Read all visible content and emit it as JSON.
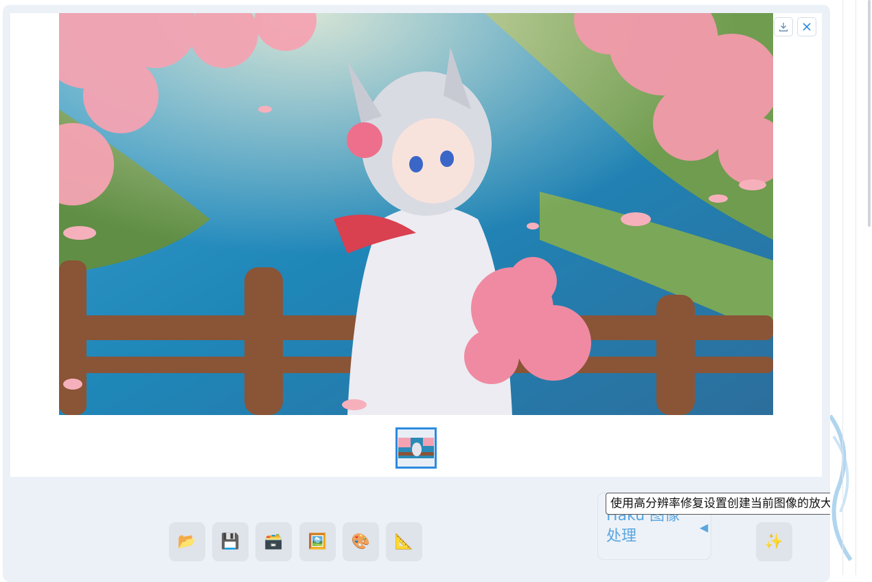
{
  "gallery": {
    "download_icon": "download-icon",
    "close_icon": "close-icon",
    "main_image_alt": "anime girl with cat ears among cherry blossoms",
    "thumbnail_count": 1
  },
  "toolbar": {
    "buttons": [
      {
        "name": "open-folder-button",
        "icon": "📂"
      },
      {
        "name": "save-button",
        "icon": "💾"
      },
      {
        "name": "zip-save-button",
        "icon": "🗃️"
      },
      {
        "name": "send-to-image-button",
        "icon": "🖼️"
      },
      {
        "name": "send-to-inpaint-button",
        "icon": "🎨"
      },
      {
        "name": "send-to-extras-button",
        "icon": "📐"
      }
    ],
    "upscale_icon": "✨"
  },
  "haku": {
    "label": "Haku 图像处理",
    "arrow": "◀"
  },
  "tooltip": {
    "text": "使用高分辨率修复设置创建当前图像的放大版本"
  },
  "colors": {
    "accent": "#2a8ae0",
    "panel_bg": "#ecf1f8",
    "button_bg": "#dfe3ea",
    "haku_text": "#5aa6e0"
  }
}
